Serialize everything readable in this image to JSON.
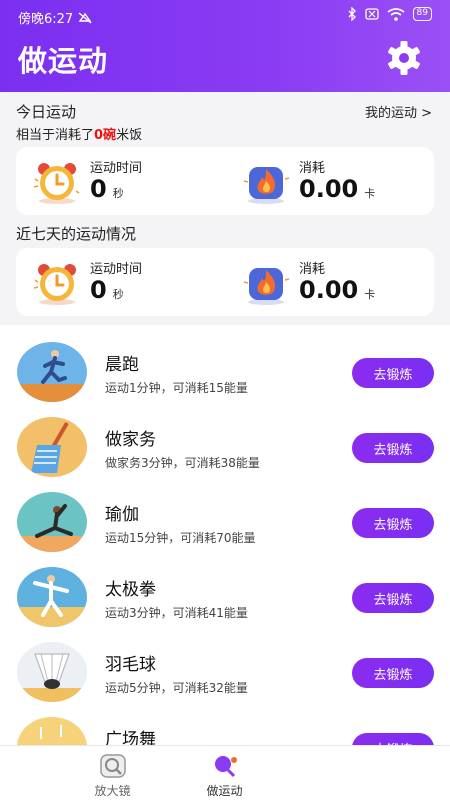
{
  "status_bar": {
    "time": "傍晚6:27",
    "battery": "89"
  },
  "header": {
    "title": "做运动"
  },
  "today": {
    "heading": "今日运动",
    "my_sport_link": "我的运动 >",
    "summary_prefix": "相当于消耗了",
    "summary_bowls": "0碗",
    "summary_suffix": "米饭",
    "time_label": "运动时间",
    "time_value": "0",
    "time_unit": "秒",
    "burn_label": "消耗",
    "burn_value": "0.00",
    "burn_unit": "卡"
  },
  "week": {
    "heading": "近七天的运动情况",
    "time_label": "运动时间",
    "time_value": "0",
    "time_unit": "秒",
    "burn_label": "消耗",
    "burn_value": "0.00",
    "burn_unit": "卡"
  },
  "activities": [
    {
      "name": "晨跑",
      "desc": "运动1分钟，可消耗15能量",
      "button": "去锻炼"
    },
    {
      "name": "做家务",
      "desc": "做家务3分钟，可消耗38能量",
      "button": "去锻炼"
    },
    {
      "name": "瑜伽",
      "desc": "运动15分钟，可消耗70能量",
      "button": "去锻炼"
    },
    {
      "name": "太极拳",
      "desc": "运动3分钟，可消耗41能量",
      "button": "去锻炼"
    },
    {
      "name": "羽毛球",
      "desc": "运动5分钟，可消耗32能量",
      "button": "去锻炼"
    },
    {
      "name": "广场舞",
      "desc": "",
      "button": "去锻炼"
    }
  ],
  "tabs": [
    {
      "label": "放大镜",
      "icon": "magnifier-icon"
    },
    {
      "label": "做运动",
      "icon": "table-tennis-icon"
    }
  ],
  "colors": {
    "accent": "#7b2ff0",
    "highlight": "#e11111"
  }
}
